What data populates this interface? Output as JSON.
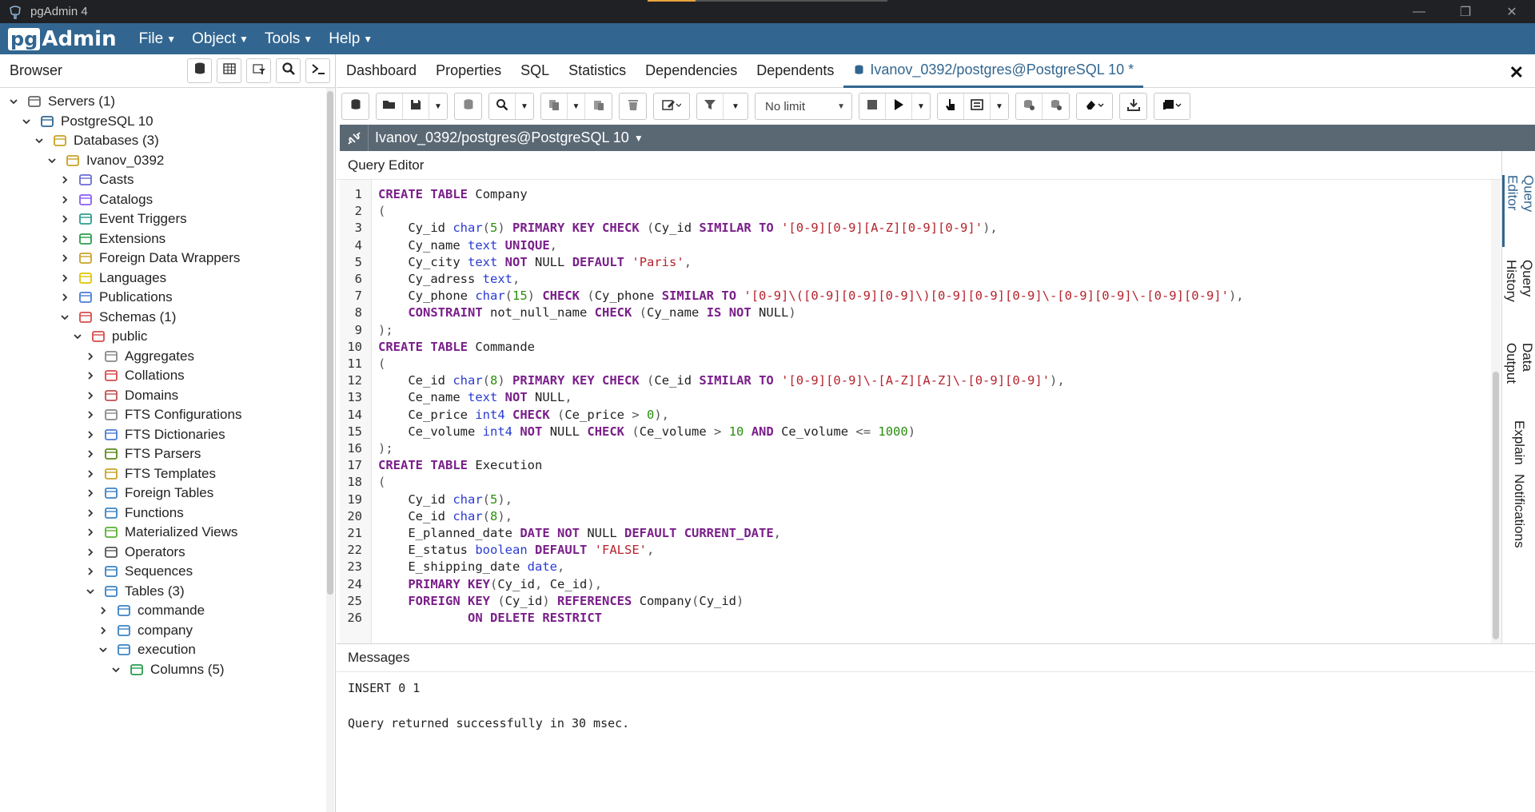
{
  "window": {
    "title": "pgAdmin 4",
    "minimize": "—",
    "maximize": "❐",
    "close": "✕"
  },
  "menubar": {
    "logo_pg": "pg",
    "logo_admin": "Admin",
    "items": [
      {
        "label": "File"
      },
      {
        "label": "Object"
      },
      {
        "label": "Tools"
      },
      {
        "label": "Help"
      }
    ]
  },
  "browser": {
    "title": "Browser",
    "tree": [
      {
        "label": "Servers (1)",
        "icon": "servers-icon",
        "expanded": true
      },
      {
        "label": "PostgreSQL 10",
        "icon": "postgresql-elephant-icon",
        "expanded": true
      },
      {
        "label": "Databases (3)",
        "icon": "databases-icon",
        "expanded": true
      },
      {
        "label": "Ivanov_0392",
        "icon": "database-icon",
        "expanded": true
      },
      {
        "label": "Casts",
        "icon": "casts-icon",
        "expanded": false
      },
      {
        "label": "Catalogs",
        "icon": "catalogs-icon",
        "expanded": false
      },
      {
        "label": "Event Triggers",
        "icon": "event-triggers-icon",
        "expanded": false
      },
      {
        "label": "Extensions",
        "icon": "extensions-icon",
        "expanded": false
      },
      {
        "label": "Foreign Data Wrappers",
        "icon": "foreign-data-wrappers-icon",
        "expanded": false
      },
      {
        "label": "Languages",
        "icon": "languages-icon",
        "expanded": false
      },
      {
        "label": "Publications",
        "icon": "publications-icon",
        "expanded": false
      },
      {
        "label": "Schemas (1)",
        "icon": "schemas-icon",
        "expanded": true
      },
      {
        "label": "public",
        "icon": "schema-icon",
        "expanded": true
      },
      {
        "label": "Aggregates",
        "icon": "aggregates-icon",
        "expanded": false
      },
      {
        "label": "Collations",
        "icon": "collations-icon",
        "expanded": false
      },
      {
        "label": "Domains",
        "icon": "domains-icon",
        "expanded": false
      },
      {
        "label": "FTS Configurations",
        "icon": "fts-configurations-icon",
        "expanded": false
      },
      {
        "label": "FTS Dictionaries",
        "icon": "fts-dictionaries-icon",
        "expanded": false
      },
      {
        "label": "FTS Parsers",
        "icon": "fts-parsers-icon",
        "expanded": false
      },
      {
        "label": "FTS Templates",
        "icon": "fts-templates-icon",
        "expanded": false
      },
      {
        "label": "Foreign Tables",
        "icon": "foreign-tables-icon",
        "expanded": false
      },
      {
        "label": "Functions",
        "icon": "functions-icon",
        "expanded": false
      },
      {
        "label": "Materialized Views",
        "icon": "materialized-views-icon",
        "expanded": false
      },
      {
        "label": "Operators",
        "icon": "operators-icon",
        "expanded": false
      },
      {
        "label": "Sequences",
        "icon": "sequences-icon",
        "expanded": false
      },
      {
        "label": "Tables (3)",
        "icon": "tables-icon",
        "expanded": true
      },
      {
        "label": "commande",
        "icon": "table-icon",
        "expanded": false
      },
      {
        "label": "company",
        "icon": "table-icon",
        "expanded": false
      },
      {
        "label": "execution",
        "icon": "table-icon",
        "expanded": true
      },
      {
        "label": "Columns (5)",
        "icon": "columns-icon",
        "expanded": true
      }
    ]
  },
  "tabs": [
    {
      "label": "Dashboard"
    },
    {
      "label": "Properties"
    },
    {
      "label": "SQL"
    },
    {
      "label": "Statistics"
    },
    {
      "label": "Dependencies"
    },
    {
      "label": "Dependents"
    },
    {
      "label": "Ivanov_0392/postgres@PostgreSQL 10 *"
    }
  ],
  "toolbar": {
    "limit_label": "No limit"
  },
  "connection": {
    "label": "Ivanov_0392/postgres@PostgreSQL 10"
  },
  "query_editor": {
    "title": "Query Editor",
    "lines": [
      "CREATE TABLE Company",
      "(",
      "    Cy_id char(5) PRIMARY KEY CHECK (Cy_id SIMILAR TO '[0-9][0-9][A-Z][0-9][0-9]'),",
      "    Cy_name text UNIQUE,",
      "    Cy_city text NOT NULL DEFAULT 'Paris',",
      "    Cy_adress text,",
      "    Cy_phone char(15) CHECK (Cy_phone SIMILAR TO '[0-9]\\([0-9][0-9][0-9]\\)[0-9][0-9][0-9]\\-[0-9][0-9]\\-[0-9][0-9]'),",
      "    CONSTRAINT not_null_name CHECK (Cy_name IS NOT NULL)",
      ");",
      "CREATE TABLE Commande",
      "(",
      "    Ce_id char(8) PRIMARY KEY CHECK (Ce_id SIMILAR TO '[0-9][0-9]\\-[A-Z][A-Z]\\-[0-9][0-9]'),",
      "    Ce_name text NOT NULL,",
      "    Ce_price int4 CHECK (Ce_price > 0),",
      "    Ce_volume int4 NOT NULL CHECK (Ce_volume > 10 AND Ce_volume <= 1000)",
      ");",
      "CREATE TABLE Execution",
      "(",
      "    Cy_id char(5),",
      "    Ce_id char(8),",
      "    E_planned_date DATE NOT NULL DEFAULT CURRENT_DATE,",
      "    E_status boolean DEFAULT 'FALSE',",
      "    E_shipping_date date,",
      "    PRIMARY KEY(Cy_id, Ce_id),",
      "    FOREIGN KEY (Cy_id) REFERENCES Company(Cy_id)",
      "            ON DELETE RESTRICT"
    ]
  },
  "side_tabs": [
    {
      "label": "Query Editor"
    },
    {
      "label": "Query History"
    },
    {
      "label": "Data Output"
    },
    {
      "label": "Explain"
    },
    {
      "label": "Notifications"
    }
  ],
  "messages": {
    "title": "Messages",
    "lines": [
      "INSERT 0 1",
      "",
      "Query returned successfully in 30 msec."
    ]
  },
  "colors": {
    "brand": "#326690",
    "titlebar": "#202124",
    "keyword": "#7a1f8a",
    "type": "#2a3bd3",
    "string": "#b5232d",
    "number": "#2a8e0d"
  }
}
